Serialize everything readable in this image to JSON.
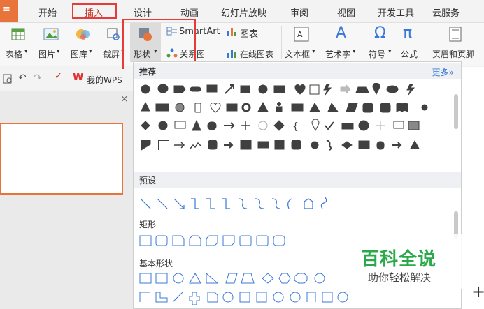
{
  "menu": {
    "wps_label": "≡",
    "tabs": [
      "开始",
      "插入",
      "设计",
      "动画",
      "幻灯片放映",
      "审阅",
      "视图",
      "开发工具",
      "云服务"
    ],
    "active_tab": "插入"
  },
  "ribbon": {
    "table": "表格",
    "picture": "图片",
    "gallery": "图库",
    "screenshot": "截屏",
    "shape": "形状",
    "smartart": "SmartArt",
    "chart": "图表",
    "relation": "关系图",
    "online_chart": "在线图表",
    "textbox": "文本框",
    "arttext": "艺术字",
    "symbol": "符号",
    "formula": "公式",
    "header_footer": "页眉和页脚"
  },
  "toolbar2": {
    "mywps": "我的WPS"
  },
  "dropdown": {
    "recommend": "推荐",
    "more": "更多»",
    "preset": "预设",
    "rect": "矩形",
    "basic": "基本形状"
  },
  "watermark": {
    "title": "百科全说",
    "subtitle": "助你轻松解决"
  },
  "colors": {
    "accent": "#e8743b",
    "highlight": "#e53b3b",
    "watermark": "#2aa94a",
    "link": "#3a78d8"
  }
}
